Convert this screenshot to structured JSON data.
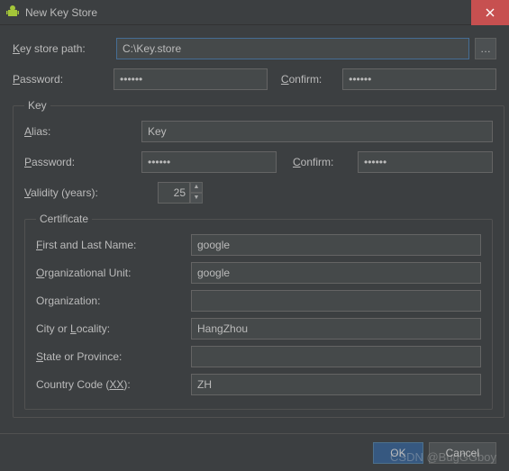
{
  "window": {
    "title": "New Key Store"
  },
  "path": {
    "label": "Key store path:",
    "label_u": "K",
    "value": "C:\\Key.store"
  },
  "pwd": {
    "label": "Password:",
    "label_u": "P",
    "value": "••••••",
    "confirm_label": "Confirm:",
    "confirm_u": "C",
    "confirm_value": "••••••"
  },
  "key": {
    "legend": "Key",
    "alias": {
      "label": "Alias:",
      "label_u": "A",
      "value": "Key"
    },
    "pwd": {
      "label": "Password:",
      "label_u": "P",
      "value": "••••••",
      "confirm_label": "Confirm:",
      "confirm_u": "C",
      "confirm_value": "••••••"
    },
    "validity": {
      "label": "Validity (years):",
      "label_u": "V",
      "value": "25"
    }
  },
  "cert": {
    "legend": "Certificate",
    "first": {
      "label": "First and Last Name:",
      "label_u": "F",
      "value": "google"
    },
    "orgunit": {
      "label": "Organizational Unit:",
      "label_u": "O",
      "value": "google"
    },
    "org": {
      "label": "Organization:",
      "value": ""
    },
    "city": {
      "label": "City or Locality:",
      "label_u": "L",
      "value": "HangZhou"
    },
    "state": {
      "label": "State or Province:",
      "label_u": "S",
      "value": ""
    },
    "country": {
      "label": "Country Code (XX):",
      "label_u": "XX",
      "value": "ZH"
    }
  },
  "buttons": {
    "ok": "OK",
    "cancel": "Cancel"
  },
  "watermark": "CSDN @BugGGboy"
}
